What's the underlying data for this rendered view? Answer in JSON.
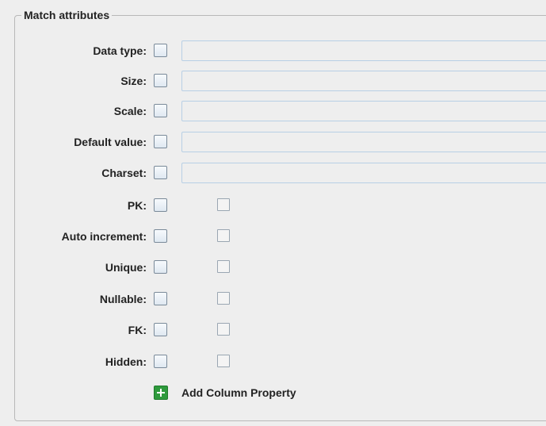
{
  "group": {
    "title": "Match attributes"
  },
  "text_rows": [
    {
      "label": "Data type:",
      "value": ""
    },
    {
      "label": "Size:",
      "value": ""
    },
    {
      "label": "Scale:",
      "value": ""
    },
    {
      "label": "Default value:",
      "value": ""
    },
    {
      "label": "Charset:",
      "value": ""
    }
  ],
  "check_rows": [
    {
      "label": "PK:",
      "match": false,
      "value": false
    },
    {
      "label": "Auto increment:",
      "match": false,
      "value": false
    },
    {
      "label": "Unique:",
      "match": false,
      "value": false
    },
    {
      "label": "Nullable:",
      "match": false,
      "value": false
    },
    {
      "label": "FK:",
      "match": false,
      "value": false
    },
    {
      "label": "Hidden:",
      "match": false,
      "value": false
    }
  ],
  "add_property": {
    "label": "Add Column Property",
    "icon": "plus-icon"
  },
  "colors": {
    "background": "#eeeeee",
    "field_border": "#b8cfe5",
    "add_icon": "#2e9a3c"
  }
}
